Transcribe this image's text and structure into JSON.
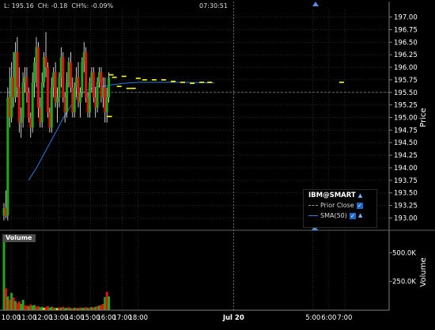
{
  "header": {
    "quote_text": "L: 195.16  CH: -0.18  CH%: -0.09%",
    "time": "07:30:51"
  },
  "legend": {
    "title": "IBM@SMART",
    "prior_close_label": "Prior Close",
    "sma_label": "SMA(50)"
  },
  "volume_panel": {
    "label": "Volume"
  },
  "colors": {
    "up": "#1aaa1a",
    "down": "#e01212",
    "wick": "#ffffff",
    "sma": "#1e7fe0",
    "prior_close": "#888888",
    "after_hours": "#ffff00",
    "grid": "#4a4a4a",
    "axis_text": "#ffffff",
    "volume_other": "#f5f500"
  },
  "chart_data": {
    "type": "candlestick",
    "ylabel": "Price",
    "ylim": [
      192.85,
      197.15
    ],
    "yticks": [
      193.0,
      193.25,
      193.5,
      193.75,
      194.0,
      194.25,
      194.5,
      194.75,
      195.0,
      195.25,
      195.5,
      195.75,
      196.0,
      196.25,
      196.5,
      196.75,
      197.0
    ],
    "ytick_labels": [
      "193.00",
      "193.25",
      "193.50",
      "193.75",
      "194.00",
      "194.25",
      "194.50",
      "194.75",
      "195.00",
      "195.25",
      "195.50",
      "195.75",
      "196.00",
      "196.25",
      "196.50",
      "196.75",
      "197.00"
    ],
    "x_tick_labels": [
      "10:00",
      "11:00",
      "12:00",
      "13:00",
      "14:00",
      "15:00",
      "16:00",
      "17:00",
      "18:00",
      "Jul 20",
      "5:00",
      "6:00",
      "7:00"
    ],
    "x_tick_hours": [
      10,
      11,
      12,
      13,
      14,
      15,
      16,
      17,
      18,
      24,
      29,
      30,
      31
    ],
    "x_range_hours": [
      9.5,
      33.5
    ],
    "prior_close": 195.5,
    "candles": [
      {
        "t": 9.55,
        "o": 193.05,
        "h": 193.3,
        "l": 192.95,
        "c": 193.2
      },
      {
        "t": 9.67,
        "o": 193.2,
        "h": 193.55,
        "l": 193.0,
        "c": 193.05
      },
      {
        "t": 9.79,
        "o": 193.05,
        "h": 195.6,
        "l": 192.95,
        "c": 195.4
      },
      {
        "t": 9.91,
        "o": 195.4,
        "h": 196.0,
        "l": 194.8,
        "c": 195.0
      },
      {
        "t": 10.03,
        "o": 195.0,
        "h": 196.1,
        "l": 194.9,
        "c": 195.8
      },
      {
        "t": 10.15,
        "o": 195.8,
        "h": 196.3,
        "l": 195.2,
        "c": 195.4
      },
      {
        "t": 10.27,
        "o": 195.4,
        "h": 196.5,
        "l": 195.3,
        "c": 196.3
      },
      {
        "t": 10.39,
        "o": 196.3,
        "h": 196.6,
        "l": 195.4,
        "c": 195.6
      },
      {
        "t": 10.51,
        "o": 195.6,
        "h": 196.0,
        "l": 194.7,
        "c": 194.9
      },
      {
        "t": 10.63,
        "o": 194.9,
        "h": 195.2,
        "l": 194.6,
        "c": 195.0
      },
      {
        "t": 10.75,
        "o": 195.0,
        "h": 195.9,
        "l": 194.8,
        "c": 195.7
      },
      {
        "t": 10.87,
        "o": 195.7,
        "h": 196.0,
        "l": 195.5,
        "c": 195.8
      },
      {
        "t": 10.99,
        "o": 195.8,
        "h": 196.0,
        "l": 195.3,
        "c": 195.5
      },
      {
        "t": 11.11,
        "o": 195.5,
        "h": 195.6,
        "l": 194.9,
        "c": 195.0
      },
      {
        "t": 11.23,
        "o": 195.0,
        "h": 195.1,
        "l": 194.6,
        "c": 194.8
      },
      {
        "t": 11.35,
        "o": 194.8,
        "h": 195.9,
        "l": 194.7,
        "c": 195.7
      },
      {
        "t": 11.47,
        "o": 195.7,
        "h": 196.2,
        "l": 195.4,
        "c": 196.1
      },
      {
        "t": 11.59,
        "o": 196.1,
        "h": 196.6,
        "l": 195.6,
        "c": 196.4
      },
      {
        "t": 11.71,
        "o": 196.4,
        "h": 196.5,
        "l": 195.0,
        "c": 195.2
      },
      {
        "t": 11.83,
        "o": 195.2,
        "h": 195.4,
        "l": 194.8,
        "c": 194.9
      },
      {
        "t": 11.95,
        "o": 194.9,
        "h": 195.9,
        "l": 194.8,
        "c": 195.7
      },
      {
        "t": 12.07,
        "o": 195.7,
        "h": 196.3,
        "l": 195.6,
        "c": 196.2
      },
      {
        "t": 12.19,
        "o": 196.2,
        "h": 196.7,
        "l": 195.8,
        "c": 196.0
      },
      {
        "t": 12.31,
        "o": 196.0,
        "h": 196.1,
        "l": 195.0,
        "c": 195.1
      },
      {
        "t": 12.43,
        "o": 195.1,
        "h": 195.2,
        "l": 194.7,
        "c": 194.8
      },
      {
        "t": 12.55,
        "o": 194.8,
        "h": 195.8,
        "l": 194.7,
        "c": 195.6
      },
      {
        "t": 12.67,
        "o": 195.6,
        "h": 196.0,
        "l": 195.4,
        "c": 195.9
      },
      {
        "t": 12.79,
        "o": 195.9,
        "h": 196.1,
        "l": 195.2,
        "c": 195.3
      },
      {
        "t": 12.91,
        "o": 195.3,
        "h": 195.6,
        "l": 194.9,
        "c": 195.4
      },
      {
        "t": 13.03,
        "o": 195.4,
        "h": 195.9,
        "l": 195.2,
        "c": 195.8
      },
      {
        "t": 13.15,
        "o": 195.8,
        "h": 196.4,
        "l": 195.6,
        "c": 196.2
      },
      {
        "t": 13.27,
        "o": 196.2,
        "h": 196.3,
        "l": 195.3,
        "c": 195.4
      },
      {
        "t": 13.39,
        "o": 195.4,
        "h": 195.5,
        "l": 194.9,
        "c": 195.1
      },
      {
        "t": 13.51,
        "o": 195.1,
        "h": 195.9,
        "l": 195.0,
        "c": 195.7
      },
      {
        "t": 13.63,
        "o": 195.7,
        "h": 196.2,
        "l": 195.6,
        "c": 196.1
      },
      {
        "t": 13.75,
        "o": 196.1,
        "h": 196.3,
        "l": 195.5,
        "c": 195.6
      },
      {
        "t": 13.87,
        "o": 195.6,
        "h": 195.8,
        "l": 195.0,
        "c": 195.1
      },
      {
        "t": 13.99,
        "o": 195.1,
        "h": 195.7,
        "l": 195.0,
        "c": 195.6
      },
      {
        "t": 14.11,
        "o": 195.6,
        "h": 196.0,
        "l": 195.4,
        "c": 195.8
      },
      {
        "t": 14.23,
        "o": 195.8,
        "h": 196.1,
        "l": 195.2,
        "c": 195.3
      },
      {
        "t": 14.35,
        "o": 195.3,
        "h": 195.6,
        "l": 195.0,
        "c": 195.5
      },
      {
        "t": 14.47,
        "o": 195.5,
        "h": 196.2,
        "l": 195.4,
        "c": 196.1
      },
      {
        "t": 14.59,
        "o": 196.1,
        "h": 196.5,
        "l": 195.9,
        "c": 196.3
      },
      {
        "t": 14.71,
        "o": 196.3,
        "h": 196.4,
        "l": 195.3,
        "c": 195.4
      },
      {
        "t": 14.83,
        "o": 195.4,
        "h": 195.5,
        "l": 195.0,
        "c": 195.1
      },
      {
        "t": 14.95,
        "o": 195.1,
        "h": 195.8,
        "l": 195.0,
        "c": 195.7
      },
      {
        "t": 15.07,
        "o": 195.7,
        "h": 196.0,
        "l": 195.5,
        "c": 195.9
      },
      {
        "t": 15.19,
        "o": 195.9,
        "h": 196.0,
        "l": 195.3,
        "c": 195.4
      },
      {
        "t": 15.31,
        "o": 195.4,
        "h": 195.6,
        "l": 195.0,
        "c": 195.2
      },
      {
        "t": 15.43,
        "o": 195.2,
        "h": 195.8,
        "l": 195.1,
        "c": 195.7
      },
      {
        "t": 15.55,
        "o": 195.7,
        "h": 196.0,
        "l": 195.6,
        "c": 195.9
      },
      {
        "t": 15.67,
        "o": 195.9,
        "h": 196.0,
        "l": 195.3,
        "c": 195.4
      },
      {
        "t": 15.79,
        "o": 195.4,
        "h": 195.8,
        "l": 195.2,
        "c": 195.6
      },
      {
        "t": 15.91,
        "o": 195.6,
        "h": 195.8,
        "l": 194.9,
        "c": 195.1
      },
      {
        "t": 16.03,
        "o": 195.1,
        "h": 195.6,
        "l": 194.9,
        "c": 195.4
      },
      {
        "t": 16.15,
        "o": 195.4,
        "h": 195.9,
        "l": 195.3,
        "c": 195.8
      }
    ],
    "after_hours_prints": [
      {
        "t": 16.3,
        "p": 195.85
      },
      {
        "t": 16.5,
        "p": 195.8
      },
      {
        "t": 16.8,
        "p": 195.62
      },
      {
        "t": 17.1,
        "p": 195.82
      },
      {
        "t": 17.4,
        "p": 195.58
      },
      {
        "t": 17.7,
        "p": 195.58
      },
      {
        "t": 18.0,
        "p": 195.78
      },
      {
        "t": 18.4,
        "p": 195.75
      },
      {
        "t": 19.0,
        "p": 195.75
      },
      {
        "t": 19.6,
        "p": 195.75
      },
      {
        "t": 20.2,
        "p": 195.72
      },
      {
        "t": 20.8,
        "p": 195.7
      },
      {
        "t": 21.4,
        "p": 195.68
      },
      {
        "t": 22.0,
        "p": 195.7
      },
      {
        "t": 22.5,
        "p": 195.7
      },
      {
        "t": 16.2,
        "p": 195.02
      },
      {
        "t": 30.8,
        "p": 195.7
      }
    ],
    "sma50": [
      {
        "t": 11.1,
        "v": 193.75
      },
      {
        "t": 11.6,
        "v": 194.0
      },
      {
        "t": 12.2,
        "v": 194.35
      },
      {
        "t": 12.8,
        "v": 194.7
      },
      {
        "t": 13.3,
        "v": 195.0
      },
      {
        "t": 13.8,
        "v": 195.25
      },
      {
        "t": 14.3,
        "v": 195.45
      },
      {
        "t": 14.8,
        "v": 195.55
      },
      {
        "t": 15.3,
        "v": 195.6
      },
      {
        "t": 15.8,
        "v": 195.62
      },
      {
        "t": 16.3,
        "v": 195.65
      },
      {
        "t": 17.0,
        "v": 195.68
      },
      {
        "t": 18.0,
        "v": 195.7
      },
      {
        "t": 19.5,
        "v": 195.7
      },
      {
        "t": 21.0,
        "v": 195.7
      },
      {
        "t": 22.8,
        "v": 195.69
      }
    ],
    "volume": {
      "ylabel": "Volume",
      "ylim": [
        0,
        660000
      ],
      "yticks": [
        250000,
        500000
      ],
      "ytick_labels": [
        "250.0K",
        "500.0K"
      ],
      "bars": [
        {
          "t": 9.55,
          "v": 610000,
          "dir": "up"
        },
        {
          "t": 9.67,
          "v": 190000,
          "dir": "down"
        },
        {
          "t": 9.79,
          "v": 120000,
          "dir": "up"
        },
        {
          "t": 9.91,
          "v": 90000,
          "dir": "down"
        },
        {
          "t": 10.03,
          "v": 150000,
          "dir": "up"
        },
        {
          "t": 10.15,
          "v": 110000,
          "dir": "down"
        },
        {
          "t": 10.27,
          "v": 80000,
          "dir": "up"
        },
        {
          "t": 10.39,
          "v": 60000,
          "dir": "down"
        },
        {
          "t": 10.51,
          "v": 75000,
          "dir": "down"
        },
        {
          "t": 10.63,
          "v": 55000,
          "dir": "up"
        },
        {
          "t": 10.75,
          "v": 90000,
          "dir": "up"
        },
        {
          "t": 10.87,
          "v": 45000,
          "dir": "down"
        },
        {
          "t": 10.99,
          "v": 40000,
          "dir": "down"
        },
        {
          "t": 11.11,
          "v": 35000,
          "dir": "up"
        },
        {
          "t": 11.23,
          "v": 50000,
          "dir": "down"
        },
        {
          "t": 11.35,
          "v": 40000,
          "dir": "up"
        },
        {
          "t": 11.47,
          "v": 45000,
          "dir": "up"
        },
        {
          "t": 11.59,
          "v": 30000,
          "dir": "down"
        },
        {
          "t": 11.71,
          "v": 35000,
          "dir": "down"
        },
        {
          "t": 11.83,
          "v": 25000,
          "dir": "up"
        },
        {
          "t": 11.95,
          "v": 30000,
          "dir": "up"
        },
        {
          "t": 12.07,
          "v": 20000,
          "dir": "other"
        },
        {
          "t": 12.19,
          "v": 28000,
          "dir": "down"
        },
        {
          "t": 12.31,
          "v": 35000,
          "dir": "down"
        },
        {
          "t": 12.43,
          "v": 22000,
          "dir": "up"
        },
        {
          "t": 12.55,
          "v": 30000,
          "dir": "up"
        },
        {
          "t": 12.67,
          "v": 25000,
          "dir": "down"
        },
        {
          "t": 12.79,
          "v": 20000,
          "dir": "up"
        },
        {
          "t": 12.91,
          "v": 18000,
          "dir": "other"
        },
        {
          "t": 13.03,
          "v": 24000,
          "dir": "down"
        },
        {
          "t": 13.15,
          "v": 22000,
          "dir": "up"
        },
        {
          "t": 13.27,
          "v": 30000,
          "dir": "down"
        },
        {
          "t": 13.39,
          "v": 18000,
          "dir": "up"
        },
        {
          "t": 13.51,
          "v": 20000,
          "dir": "up"
        },
        {
          "t": 13.63,
          "v": 26000,
          "dir": "down"
        },
        {
          "t": 13.75,
          "v": 18000,
          "dir": "up"
        },
        {
          "t": 13.87,
          "v": 16000,
          "dir": "down"
        },
        {
          "t": 13.99,
          "v": 22000,
          "dir": "up"
        },
        {
          "t": 14.11,
          "v": 20000,
          "dir": "down"
        },
        {
          "t": 14.23,
          "v": 17000,
          "dir": "up"
        },
        {
          "t": 14.35,
          "v": 24000,
          "dir": "down"
        },
        {
          "t": 14.47,
          "v": 19000,
          "dir": "up"
        },
        {
          "t": 14.59,
          "v": 21000,
          "dir": "up"
        },
        {
          "t": 14.71,
          "v": 26000,
          "dir": "down"
        },
        {
          "t": 14.83,
          "v": 20000,
          "dir": "up"
        },
        {
          "t": 14.95,
          "v": 22000,
          "dir": "down"
        },
        {
          "t": 15.07,
          "v": 28000,
          "dir": "up"
        },
        {
          "t": 15.19,
          "v": 24000,
          "dir": "down"
        },
        {
          "t": 15.31,
          "v": 30000,
          "dir": "up"
        },
        {
          "t": 15.43,
          "v": 35000,
          "dir": "down"
        },
        {
          "t": 15.55,
          "v": 40000,
          "dir": "up"
        },
        {
          "t": 15.67,
          "v": 45000,
          "dir": "down"
        },
        {
          "t": 15.79,
          "v": 55000,
          "dir": "down"
        },
        {
          "t": 15.91,
          "v": 115000,
          "dir": "up"
        },
        {
          "t": 16.03,
          "v": 160000,
          "dir": "down"
        },
        {
          "t": 16.15,
          "v": 120000,
          "dir": "up"
        }
      ]
    }
  }
}
